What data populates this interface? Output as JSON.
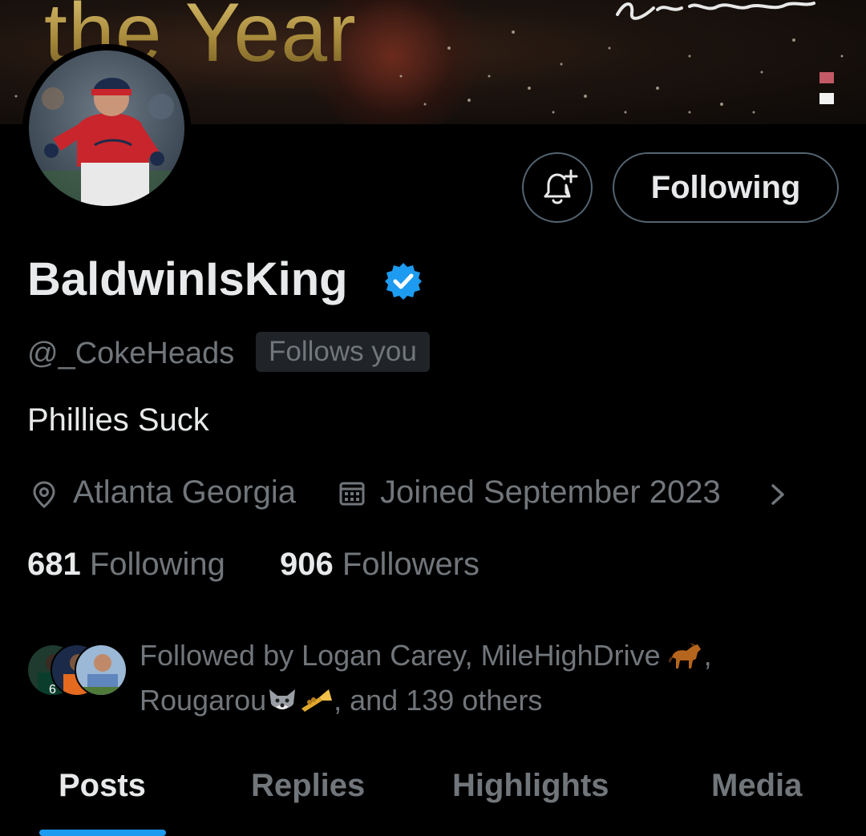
{
  "banner": {
    "text": "the Year",
    "signature": "Dick Brotherton"
  },
  "actions": {
    "following_label": "Following"
  },
  "profile": {
    "display_name": "BaldwinIsKing",
    "handle": "@_CokeHeads",
    "follows_you": "Follows you",
    "bio": "Phillies Suck",
    "location": "Atlanta Georgia",
    "joined": "Joined September 2023"
  },
  "stats": {
    "following_count": "681",
    "following_label": "Following",
    "followers_count": "906",
    "followers_label": "Followers"
  },
  "followed_by": {
    "line1_prefix": "Followed by Logan Carey, MileHighDrive",
    "line1_suffix": ",",
    "line2_name": "Rougarou",
    "line2_suffix": ", and 139 others"
  },
  "tabs": [
    {
      "label": "Posts",
      "active": true
    },
    {
      "label": "Replies",
      "active": false
    },
    {
      "label": "Highlights",
      "active": false
    },
    {
      "label": "Media",
      "active": false
    }
  ],
  "colors": {
    "accent": "#1d9bf0",
    "background": "#000000",
    "primary_text": "#e7e9ea",
    "secondary_text": "#71767b"
  },
  "icons": [
    "notification-bell-plus-icon",
    "verified-badge-icon",
    "location-pin-icon",
    "calendar-icon",
    "chevron-right-icon",
    "horse-emoji",
    "wolf-emoji",
    "trumpet-emoji"
  ]
}
